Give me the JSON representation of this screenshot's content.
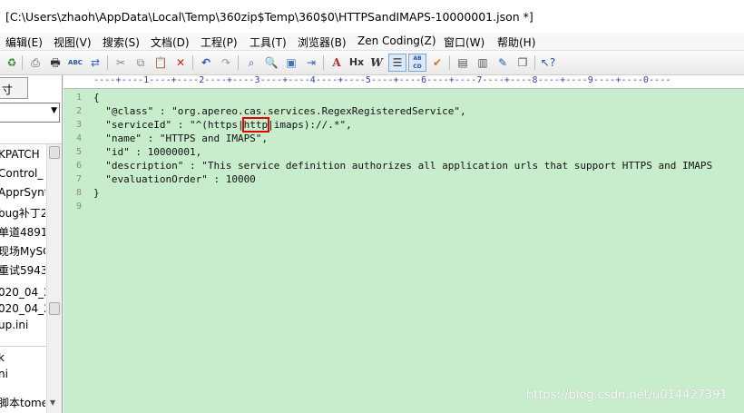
{
  "window": {
    "title": "[C:\\Users\\zhaoh\\AppData\\Local\\Temp\\360zip$Temp\\360$0\\HTTPSandIMAPS-10000001.json *]"
  },
  "menu": [
    {
      "label": "编辑(E)"
    },
    {
      "label": "视图(V)"
    },
    {
      "label": "搜索(S)"
    },
    {
      "label": "文档(D)"
    },
    {
      "label": "工程(P)"
    },
    {
      "label": "工具(T)"
    },
    {
      "label": "浏览器(B)"
    },
    {
      "label": "Zen Coding(Z)"
    },
    {
      "label": "窗口(W)"
    },
    {
      "label": "帮助(H)"
    }
  ],
  "toolbar": {
    "spell_label": "ABC",
    "font_label": "A",
    "hex_label": "Hx",
    "wrap_label": "W",
    "case_label": "AB CD"
  },
  "left_panel": {
    "tab_label": "寸",
    "list1": [
      "KPATCH",
      "Control_",
      "ApprSynt",
      "bug补丁2",
      "单道4891",
      "现场MySC",
      "重试5943"
    ],
    "list2": [
      "020_04_2",
      "020_04_2",
      "up.ini",
      "",
      "k",
      "ni",
      "",
      "脚本tome"
    ]
  },
  "editor": {
    "ruler": "----+----1----+----2----+----3----+----4----+----5----+----6----+----7----+----8----+----9----+----0----",
    "lines": [
      {
        "num": "1",
        "before": "{",
        "hl": "",
        "after": ""
      },
      {
        "num": "2",
        "before": "  \"@class\" : \"org.apereo.cas.services.RegexRegisteredService\",",
        "hl": "",
        "after": ""
      },
      {
        "num": "3",
        "before": "  \"serviceId\" : \"^(https|",
        "hl": "http",
        "after": "|imaps)://.*\","
      },
      {
        "num": "4",
        "before": "  \"name\" : \"HTTPS and IMAPS\",",
        "hl": "",
        "after": ""
      },
      {
        "num": "5",
        "before": "  \"id\" : 10000001,",
        "hl": "",
        "after": ""
      },
      {
        "num": "6",
        "before": "  \"description\" : \"This service definition authorizes all application urls that support HTTPS and IMAPS",
        "hl": "",
        "after": ""
      },
      {
        "num": "7",
        "before": "  \"evaluationOrder\" : 10000",
        "hl": "",
        "after": ""
      },
      {
        "num": "8",
        "before": "}",
        "hl": "",
        "after": ""
      },
      {
        "num": "9",
        "before": "",
        "hl": "",
        "after": ""
      }
    ],
    "background": "#c7edcc",
    "highlight_color": "#e00000"
  },
  "watermark": "https://blog.csdn.net/u014427391"
}
